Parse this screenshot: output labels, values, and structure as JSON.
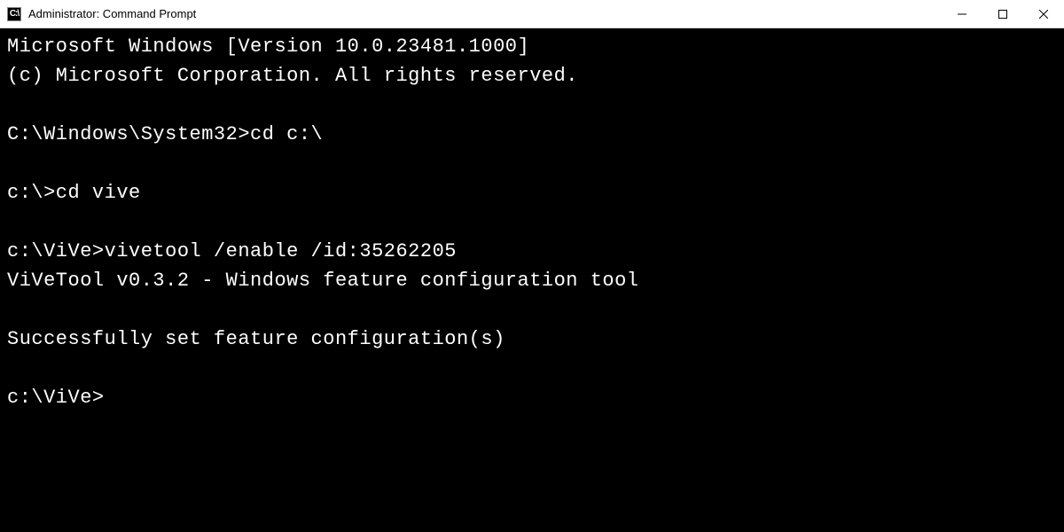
{
  "window": {
    "title": "Administrator: Command Prompt",
    "icon_label": "C:\\"
  },
  "terminal": {
    "lines": [
      "Microsoft Windows [Version 10.0.23481.1000]",
      "(c) Microsoft Corporation. All rights reserved.",
      "",
      "C:\\Windows\\System32>cd c:\\",
      "",
      "c:\\>cd vive",
      "",
      "c:\\ViVe>vivetool /enable /id:35262205",
      "ViVeTool v0.3.2 - Windows feature configuration tool",
      "",
      "Successfully set feature configuration(s)",
      "",
      "c:\\ViVe>"
    ]
  }
}
